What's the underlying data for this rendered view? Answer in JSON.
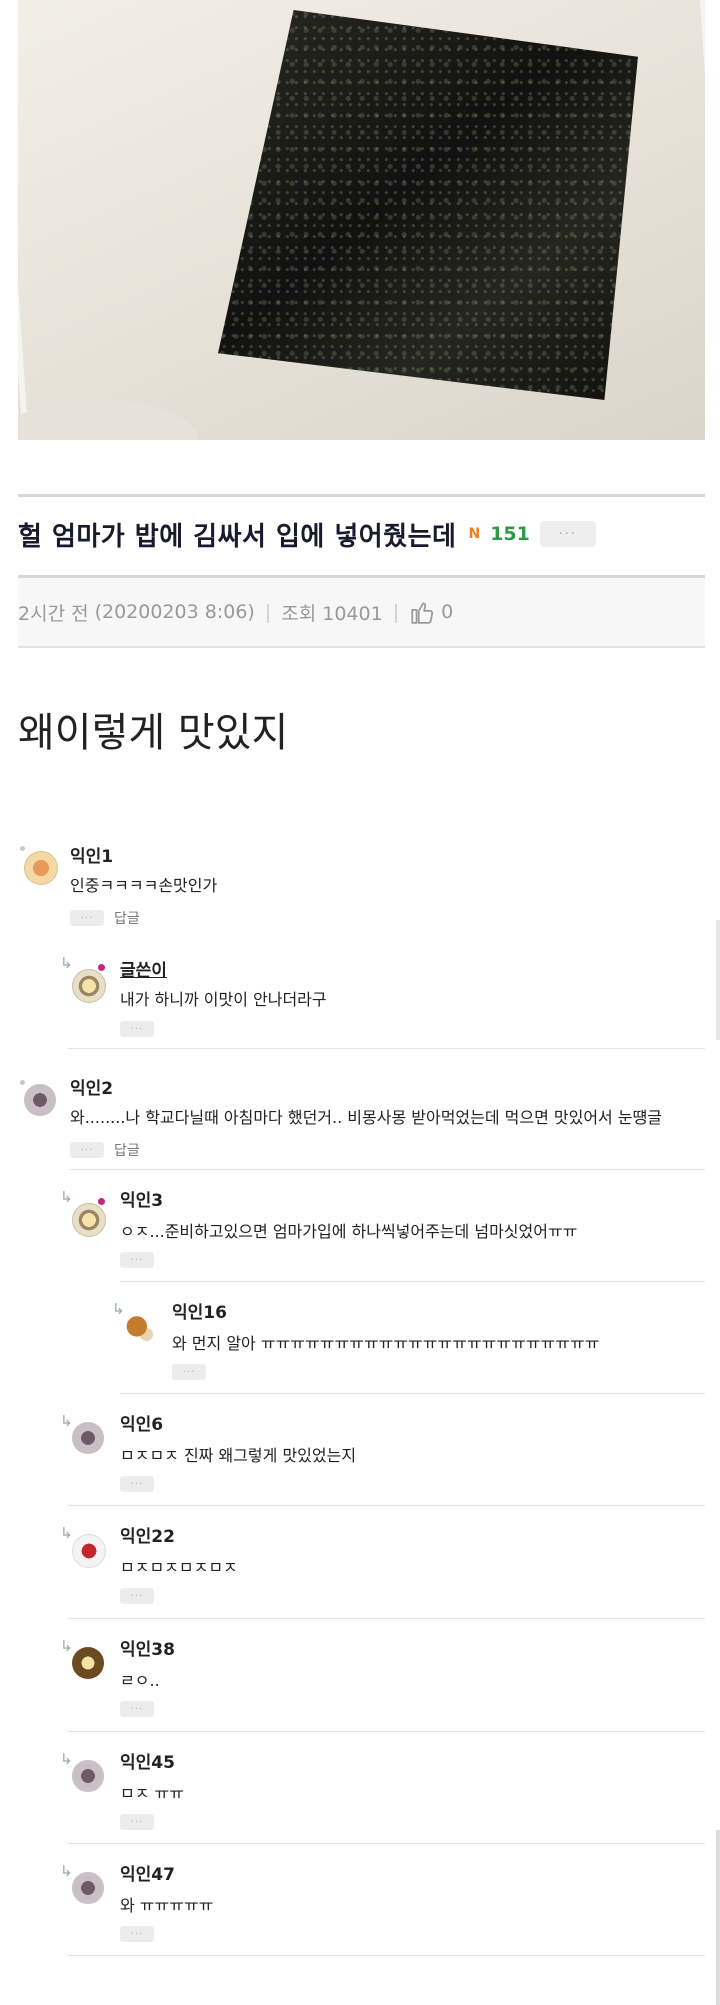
{
  "post": {
    "title": "헐 엄마가 밥에 김싸서 입에 넣어줬는데",
    "new_badge": "N",
    "comment_count": "151",
    "more_label": "···",
    "time_ago": "2시간 전",
    "datetime": "(20200203 8:06)",
    "views": "조회 10401",
    "likes": "0",
    "body": "왜이렇게 맛있지"
  },
  "comments": [
    {
      "nick": "익인1",
      "text": "인중ㅋㅋㅋㅋ손맛인가",
      "more": "···",
      "reply": "답글"
    },
    {
      "nick": "글쓴이",
      "text": "내가 하니까 이맛이 안나더라구",
      "more": "···"
    },
    {
      "nick": "익인2",
      "text": "와........나 학교다닐때 아침마다 했던거.. 비몽사몽 받아먹었는데 먹으면 맛있어서 눈떙글",
      "more": "···",
      "reply": "답글"
    },
    {
      "nick": "익인3",
      "text": "ㅇㅈ...준비하고있으면 엄마가입에 하나씩넣어주는데 넘마싯었어ㅠㅠ",
      "more": "···"
    },
    {
      "nick": "익인16",
      "text": "와 먼지 알아 ㅠㅠㅠㅠㅠㅠㅠㅠㅠㅠㅠㅠㅠㅠㅠㅠㅠㅠㅠㅠㅠㅠㅠ",
      "more": "···"
    },
    {
      "nick": "익인6",
      "text": "ㅁㅈㅁㅈ 진짜 왜그렇게 맛있었는지",
      "more": "···"
    },
    {
      "nick": "익인22",
      "text": "ㅁㅈㅁㅈㅁㅈㅁㅈ",
      "more": "···"
    },
    {
      "nick": "익인38",
      "text": "ㄹㅇ..",
      "more": "···"
    },
    {
      "nick": "익인45",
      "text": "ㅁㅈ ㅠㅠ",
      "more": "···"
    },
    {
      "nick": "익인47",
      "text": "와 ㅠㅠㅠㅠㅠ",
      "more": "···"
    }
  ],
  "reply_arrow": "↳",
  "icons": {
    "like": "thumbs-up-icon",
    "reply": "reply-arrow-icon"
  }
}
